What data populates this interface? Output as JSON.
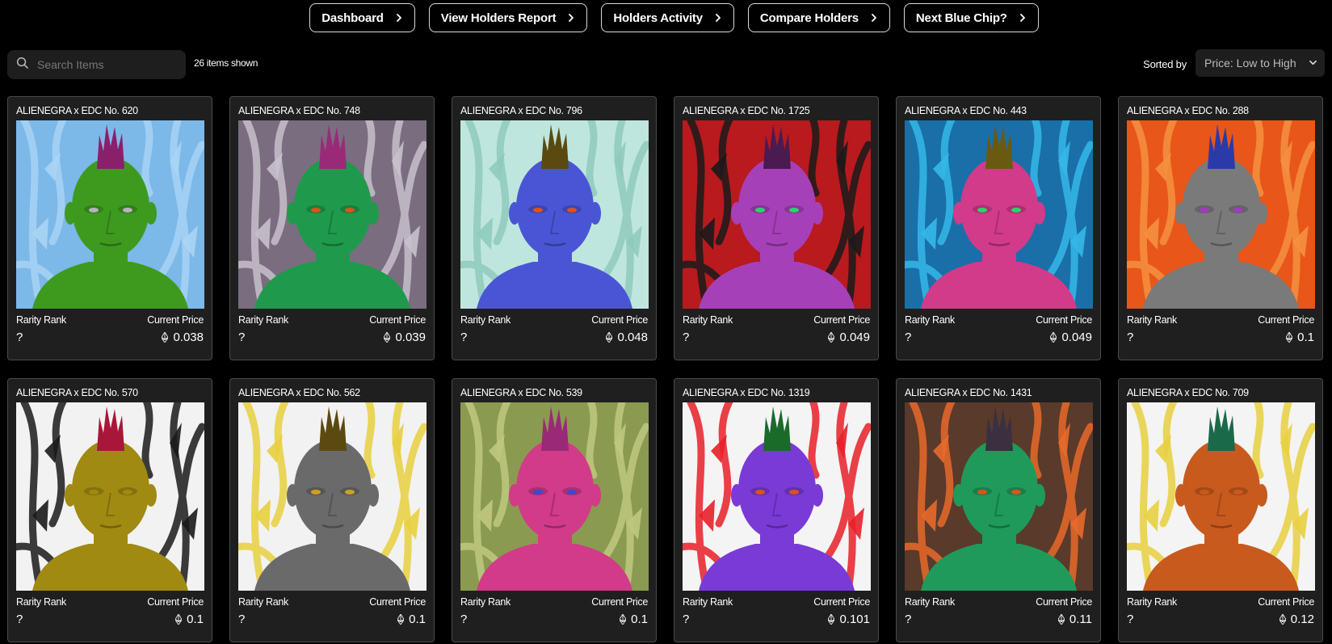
{
  "nav": [
    {
      "label": "Dashboard"
    },
    {
      "label": "View Holders Report"
    },
    {
      "label": "Holders Activity"
    },
    {
      "label": "Compare Holders"
    },
    {
      "label": "Next Blue Chip?"
    }
  ],
  "toolbar": {
    "search_placeholder": "Search Items",
    "items_shown": "26 items shown",
    "sorted_by_label": "Sorted by",
    "sort_value": "Price: Low to High"
  },
  "card_labels": {
    "rank": "Rarity Rank",
    "price": "Current Price"
  },
  "items": [
    {
      "title": "ALIENEGRA x EDC No. 620",
      "rank": "?",
      "price": "0.038",
      "bg": "#7cb8e8",
      "pattern": "#a8d4f5",
      "skin": "#3e9a1e",
      "hair": "#8a1f6a",
      "eyes": "#b9b0c8"
    },
    {
      "title": "ALIENEGRA x EDC No. 748",
      "rank": "?",
      "price": "0.039",
      "bg": "#7a6d80",
      "pattern": "#c8c0cc",
      "skin": "#1f9a4c",
      "hair": "#9a2a78",
      "eyes": "#d9541a"
    },
    {
      "title": "ALIENEGRA x EDC No. 796",
      "rank": "?",
      "price": "0.048",
      "bg": "#bfe6de",
      "pattern": "#8fcabe",
      "skin": "#4a55d6",
      "hair": "#5a4a10",
      "eyes": "#d9541a"
    },
    {
      "title": "ALIENEGRA x EDC No. 1725",
      "rank": "?",
      "price": "0.049",
      "bg": "#b81a1e",
      "pattern": "#1a1a1a",
      "skin": "#a640b8",
      "hair": "#4a1a50",
      "eyes": "#2ad46a"
    },
    {
      "title": "ALIENEGRA x EDC No. 443",
      "rank": "?",
      "price": "0.049",
      "bg": "#1a6fa8",
      "pattern": "#35b8e8",
      "skin": "#d23a8a",
      "hair": "#6a5a10",
      "eyes": "#2ad46a"
    },
    {
      "title": "ALIENEGRA x EDC No. 288",
      "rank": "?",
      "price": "0.1",
      "bg": "#e8561a",
      "pattern": "#f59040",
      "skin": "#7a7a7a",
      "hair": "#2a3aa8",
      "eyes": "#a03ac0"
    },
    {
      "title": "ALIENEGRA x EDC No. 570",
      "rank": "?",
      "price": "0.1",
      "bg": "#f2f2f2",
      "pattern": "#1a1a1a",
      "skin": "#a08a12",
      "hair": "#a8163a",
      "eyes": "#a08a12"
    },
    {
      "title": "ALIENEGRA x EDC No. 562",
      "rank": "?",
      "price": "0.1",
      "bg": "#f2f2f2",
      "pattern": "#e8d040",
      "skin": "#6a6a6a",
      "hair": "#5a4a10",
      "eyes": "#d0a020"
    },
    {
      "title": "ALIENEGRA x EDC No. 539",
      "rank": "?",
      "price": "0.1",
      "bg": "#8a9a50",
      "pattern": "#c0c880",
      "skin": "#d23a8a",
      "hair": "#9a2a78",
      "eyes": "#3a4ad0"
    },
    {
      "title": "ALIENEGRA x EDC No. 1319",
      "rank": "?",
      "price": "0.101",
      "bg": "#f4f4f4",
      "pattern": "#e8202a",
      "skin": "#7a3ad6",
      "hair": "#1a6a2a",
      "eyes": "#d9541a"
    },
    {
      "title": "ALIENEGRA x EDC No. 1431",
      "rank": "?",
      "price": "0.11",
      "bg": "#5a3a2a",
      "pattern": "#e86a2a",
      "skin": "#1f9a5a",
      "hair": "#3a3040",
      "eyes": "#d9541a"
    },
    {
      "title": "ALIENEGRA x EDC No. 709",
      "rank": "?",
      "price": "0.12",
      "bg": "#f4f4f4",
      "pattern": "#e8d040",
      "skin": "#c85a1e",
      "hair": "#1a6a4a",
      "eyes": "#c85a1e"
    }
  ]
}
